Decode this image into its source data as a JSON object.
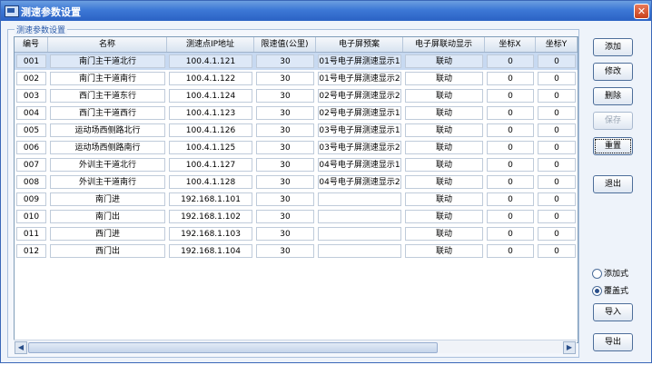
{
  "window": {
    "title": "测速参数设置",
    "close_label": "✕"
  },
  "group": {
    "title": "测速参数设置"
  },
  "columns": [
    "编号",
    "名称",
    "测速点IP地址",
    "限速值(公里)",
    "电子屏预案",
    "电子屏联动显示",
    "坐标X",
    "坐标Y"
  ],
  "rows": [
    [
      "001",
      "南门主干道北行",
      "100.4.1.121",
      "30",
      "01号电子屏测速显示1",
      "联动",
      "0",
      "0"
    ],
    [
      "002",
      "南门主干道南行",
      "100.4.1.122",
      "30",
      "01号电子屏测速显示2",
      "联动",
      "0",
      "0"
    ],
    [
      "003",
      "西门主干道东行",
      "100.4.1.124",
      "30",
      "02号电子屏测速显示2",
      "联动",
      "0",
      "0"
    ],
    [
      "004",
      "西门主干道西行",
      "100.4.1.123",
      "30",
      "02号电子屏测速显示1",
      "联动",
      "0",
      "0"
    ],
    [
      "005",
      "运动场西侧路北行",
      "100.4.1.126",
      "30",
      "03号电子屏测速显示1",
      "联动",
      "0",
      "0"
    ],
    [
      "006",
      "运动场西侧路南行",
      "100.4.1.125",
      "30",
      "03号电子屏测速显示2",
      "联动",
      "0",
      "0"
    ],
    [
      "007",
      "外训主干道北行",
      "100.4.1.127",
      "30",
      "04号电子屏测速显示1",
      "联动",
      "0",
      "0"
    ],
    [
      "008",
      "外训主干道南行",
      "100.4.1.128",
      "30",
      "04号电子屏测速显示2",
      "联动",
      "0",
      "0"
    ],
    [
      "009",
      "南门进",
      "192.168.1.101",
      "30",
      "",
      "联动",
      "0",
      "0"
    ],
    [
      "010",
      "南门出",
      "192.168.1.102",
      "30",
      "",
      "联动",
      "0",
      "0"
    ],
    [
      "011",
      "西门进",
      "192.168.1.103",
      "30",
      "",
      "联动",
      "0",
      "0"
    ],
    [
      "012",
      "西门出",
      "192.168.1.104",
      "30",
      "",
      "联动",
      "0",
      "0"
    ]
  ],
  "buttons": {
    "add": "添加",
    "edit": "修改",
    "delete": "删除",
    "save": "保存",
    "reset": "重置",
    "exit": "退出",
    "import": "导入",
    "export": "导出"
  },
  "radios": {
    "append": "添加式",
    "overwrite": "覆盖式",
    "selected": "overwrite"
  },
  "scroll": {
    "left": "◀",
    "right": "▶"
  }
}
